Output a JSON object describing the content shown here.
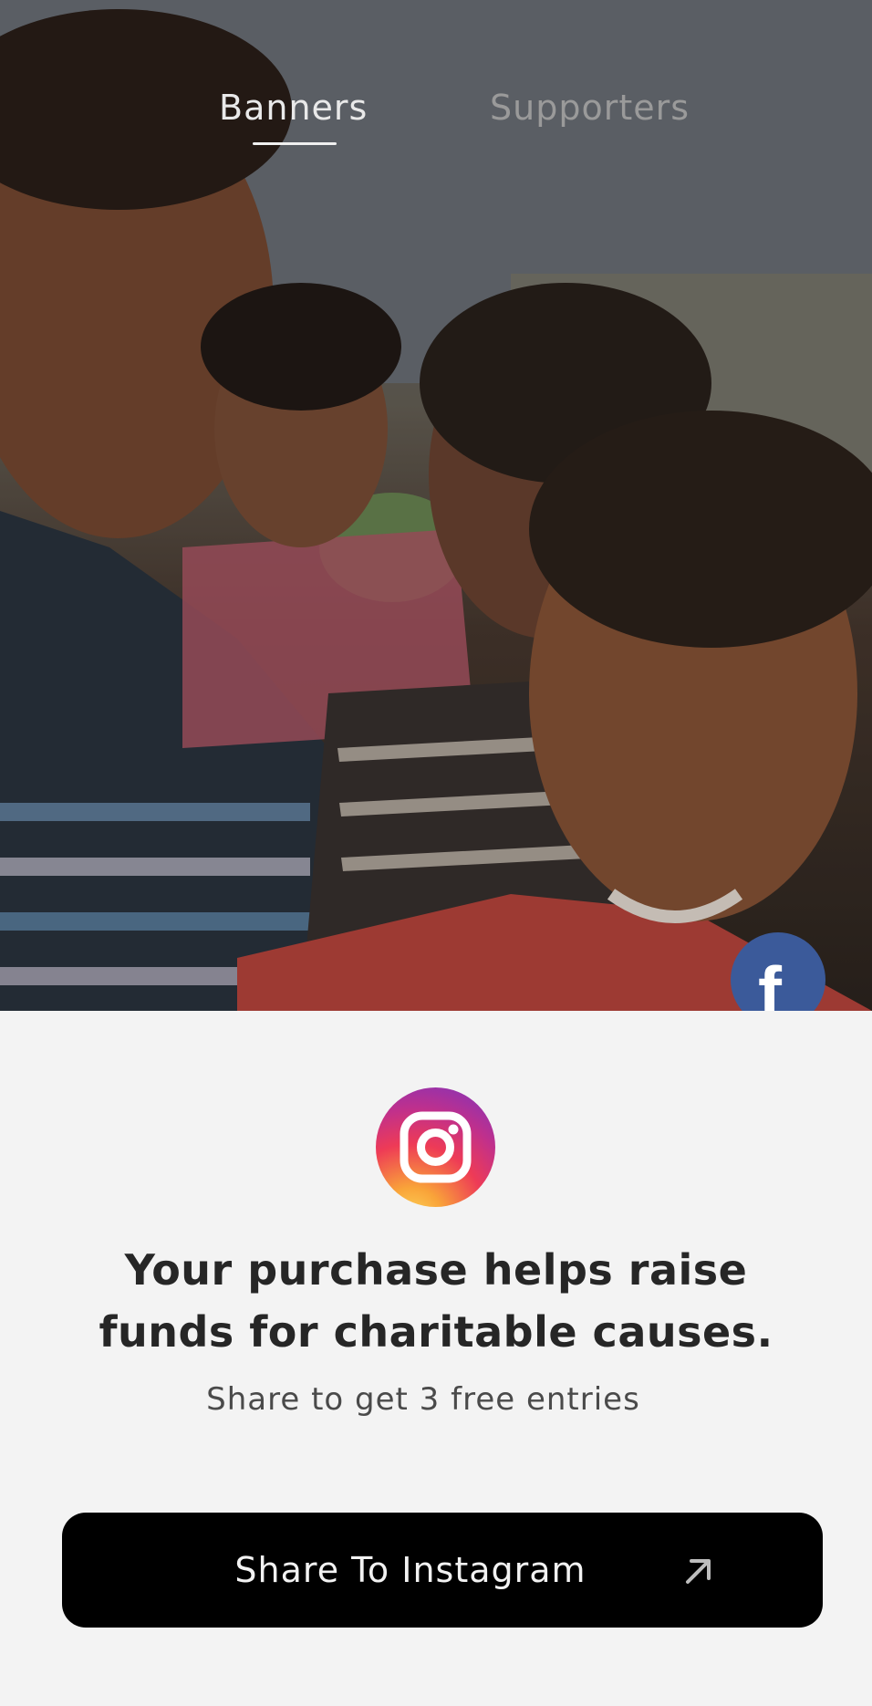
{
  "tabs": {
    "banners": "Banners",
    "supporters": "Supporters",
    "active": "Banners"
  },
  "hero": {
    "image_desc_icon": "photo-of-smiling-boys",
    "facebook_icon": "facebook-icon",
    "facebook_letter": "f",
    "facebook_color": "#3b5a9a"
  },
  "share": {
    "instagram_icon": "instagram-icon",
    "headline": "Your purchase helps raise funds for charitable causes.",
    "subline": "Share to get 3 free entries",
    "button_label": "Share To Instagram",
    "button_icon": "arrow-up-right-icon",
    "button_color": "#000000"
  }
}
